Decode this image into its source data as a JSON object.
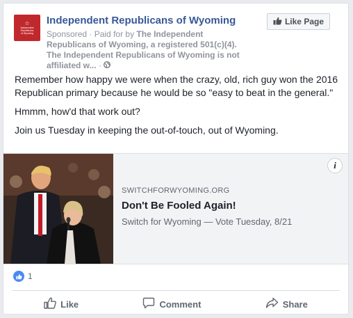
{
  "post": {
    "page_name": "Independent Republicans of Wyoming",
    "logo_text": [
      "Independent",
      "Republicans",
      "of Wyoming"
    ],
    "sponsored_label": "Sponsored",
    "paid_for_by_prefix": " · Paid for by ",
    "paid_for_by": "The Independent Republicans of Wyoming, a registered 501(c)(4). The Independent Republicans of Wyoming is not affiliated w...",
    "separator": " · ",
    "like_page_label": "Like Page",
    "body": [
      "Remember how happy we were when the crazy, old, rich guy won the 2016 Republican primary because he would be so \"easy to beat in the general.\"",
      "Hmmm, how'd that work out?",
      "Join us Tuesday in keeping the out-of-touch, out of Wyoming."
    ]
  },
  "link_preview": {
    "domain": "SWITCHFORWYOMING.ORG",
    "headline": "Don't Be Fooled Again!",
    "description": "Switch for Wyoming — Vote Tuesday, 8/21",
    "info_label": "i"
  },
  "reactions": {
    "count": "1"
  },
  "actions": {
    "like": "Like",
    "comment": "Comment",
    "share": "Share"
  },
  "colors": {
    "brand_blue": "#385898",
    "logo_red": "#c0282d",
    "muted": "#606770"
  },
  "icons": [
    "thumbs-up-icon",
    "globe-icon",
    "info-icon",
    "comment-icon",
    "share-icon",
    "like-reaction-icon"
  ]
}
